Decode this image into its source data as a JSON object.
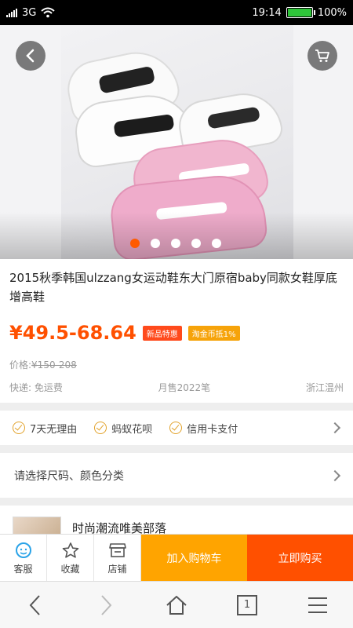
{
  "status": {
    "network": "3G",
    "time": "19:14",
    "battery": "100%",
    "battery_level": 1.0
  },
  "hero": {
    "slides_total": 5,
    "active_slide": 1
  },
  "product": {
    "title": "2015秋季韩国ulzzang女运动鞋东大门原宿baby同款女鞋厚底增高鞋",
    "price": "¥49.5-68.64",
    "badges": [
      "新品特惠",
      "淘金币抵1%"
    ],
    "original_price_label": "价格:",
    "original_price": "¥150-208",
    "shipping": "快递: 免运费",
    "monthly_sales": "月售2022笔",
    "location": "浙江温州"
  },
  "services": [
    "7天无理由",
    "蚂蚁花呗",
    "信用卡支付"
  ],
  "select_prompt": "请选择尺码、颜色分类",
  "shop": {
    "name": "时尚潮流唯美部落"
  },
  "actions": {
    "customer_service": "客服",
    "favorite": "收藏",
    "store": "店铺",
    "add_to_cart": "加入购物车",
    "buy_now": "立即购买"
  },
  "nav": {
    "tab_count": "1"
  },
  "colors": {
    "accent": "#ff5000",
    "cart_button": "#ffa400",
    "indicator_active": "#ff5a00",
    "service_check": "#e2a22b"
  }
}
